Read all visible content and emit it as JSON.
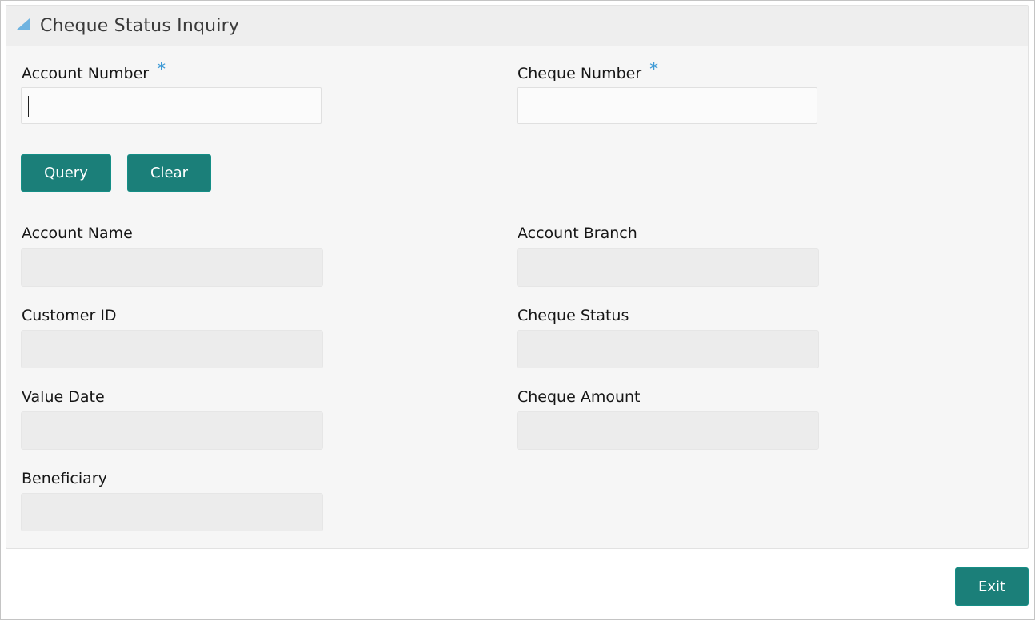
{
  "panel": {
    "title": "Cheque Status Inquiry",
    "collapse_icon": "triangle-collapse-icon"
  },
  "form": {
    "account_number": {
      "label": "Account Number",
      "required_marker": "*",
      "value": "",
      "placeholder": ""
    },
    "cheque_number": {
      "label": "Cheque Number",
      "required_marker": "*",
      "value": "",
      "placeholder": ""
    }
  },
  "actions": {
    "query_label": "Query",
    "clear_label": "Clear"
  },
  "results": {
    "account_name": {
      "label": "Account Name",
      "value": ""
    },
    "account_branch": {
      "label": "Account Branch",
      "value": ""
    },
    "customer_id": {
      "label": "Customer ID",
      "value": ""
    },
    "cheque_status": {
      "label": "Cheque Status",
      "value": ""
    },
    "value_date": {
      "label": "Value Date",
      "value": ""
    },
    "cheque_amount": {
      "label": "Cheque Amount",
      "value": ""
    },
    "beneficiary": {
      "label": "Beneficiary",
      "value": ""
    }
  },
  "footer": {
    "exit_label": "Exit"
  },
  "colors": {
    "accent": "#1b7f79",
    "required": "#3d9ad6",
    "collapse_icon": "#6fb3e0"
  }
}
